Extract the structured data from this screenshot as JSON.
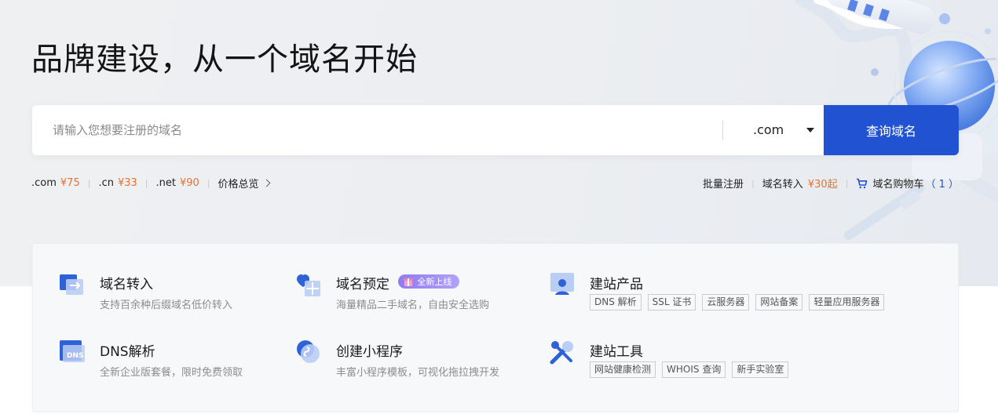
{
  "hero": {
    "title": "品牌建设，从一个域名开始"
  },
  "search": {
    "placeholder": "请输入您想要注册的域名",
    "value": "",
    "tld_selected": ".com",
    "button_label": "查询域名"
  },
  "prices": {
    "items": [
      {
        "tld": ".com",
        "price": "¥75"
      },
      {
        "tld": ".cn",
        "price": "¥33"
      },
      {
        "tld": ".net",
        "price": "¥90"
      }
    ],
    "overview_label": "价格总览"
  },
  "quick_links": {
    "bulk_register": "批量注册",
    "transfer_label": "域名转入",
    "transfer_price": "¥30起",
    "cart_label": "域名购物车",
    "cart_count": "（ 1 ）"
  },
  "features": {
    "transfer": {
      "name": "域名转入",
      "desc": "支持百余种后缀域名低价转入",
      "icon": "domain-transfer-icon"
    },
    "reserve": {
      "name": "域名预定",
      "badge": "全新上线",
      "desc": "海量精品二手域名，自由安全选购",
      "icon": "domain-reserve-icon"
    },
    "site_products": {
      "name": "建站产品",
      "tags": [
        "DNS 解析",
        "SSL 证书",
        "云服务器",
        "网站备案",
        "轻量应用服务器"
      ],
      "icon": "site-products-icon"
    },
    "dns": {
      "name": "DNS解析",
      "desc": "全新企业版套餐，限时免费领取",
      "icon": "dns-icon"
    },
    "miniprogram": {
      "name": "创建小程序",
      "desc": "丰富小程序模板，可视化拖拉拽开发",
      "icon": "mini-program-icon"
    },
    "site_tools": {
      "name": "建站工具",
      "tags": [
        "网站健康检测",
        "WHOIS 查询",
        "新手实验室"
      ],
      "icon": "site-tools-icon"
    }
  },
  "colors": {
    "accent": "#2152d1",
    "price": "#e8722c",
    "badge": "#9b87f5"
  }
}
